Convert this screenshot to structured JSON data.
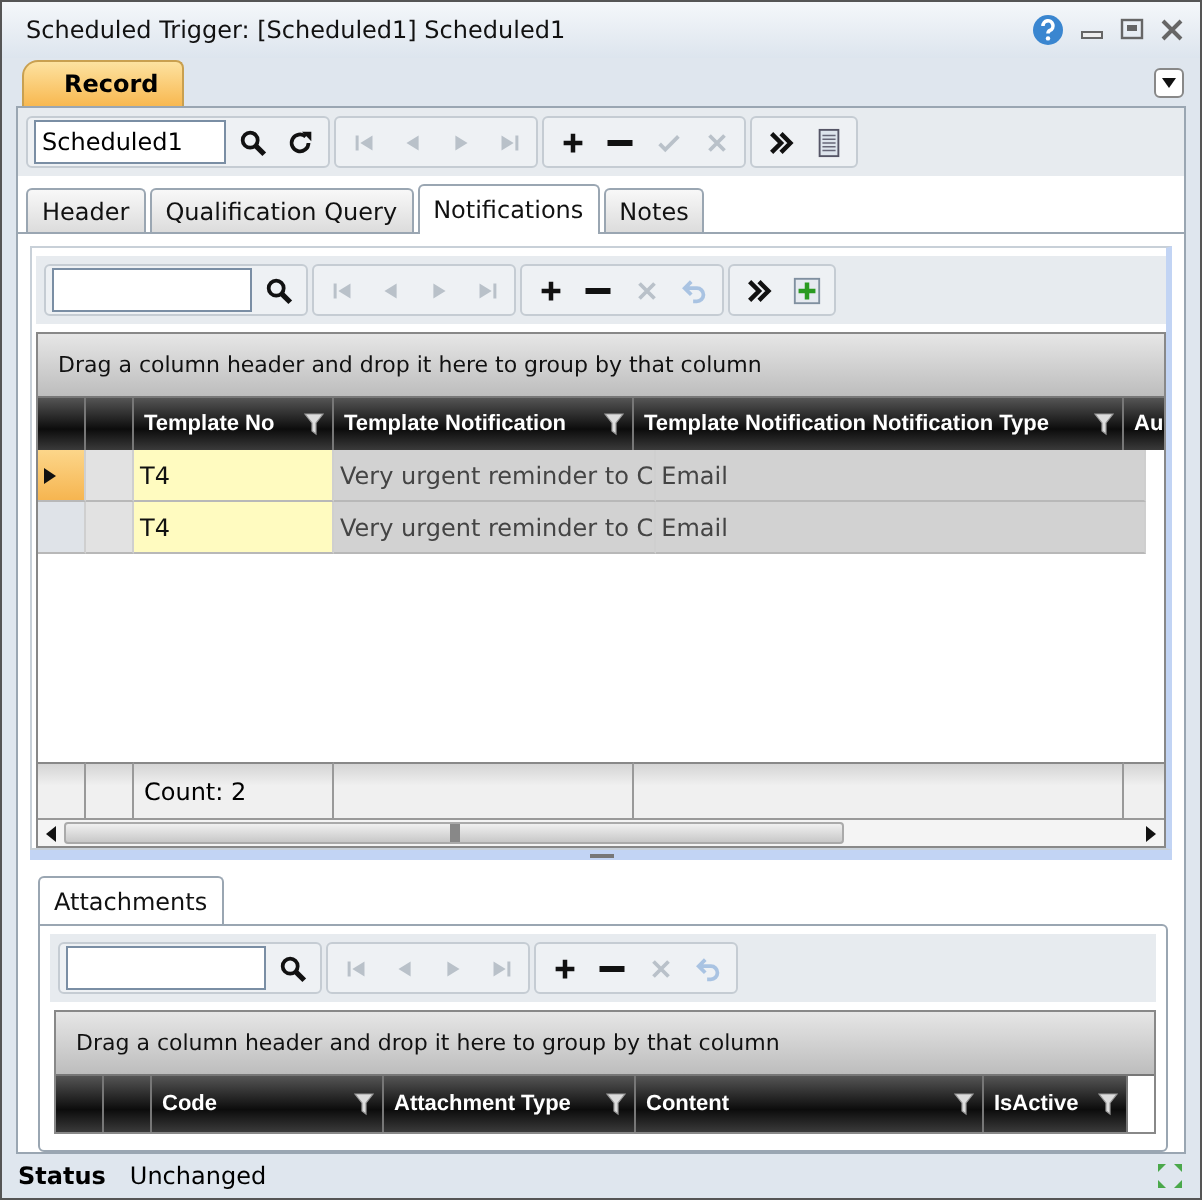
{
  "window": {
    "title": "Scheduled Trigger: [Scheduled1] Scheduled1"
  },
  "record_tab": {
    "label": "Record",
    "selected": true
  },
  "record_toolbar": {
    "value": "Scheduled1",
    "groups": [
      [
        {
          "kind": "search",
          "disabled": false
        },
        {
          "kind": "refresh",
          "disabled": false
        }
      ],
      [
        {
          "kind": "first",
          "disabled": true
        },
        {
          "kind": "previous",
          "disabled": true
        },
        {
          "kind": "next",
          "disabled": true
        },
        {
          "kind": "last",
          "disabled": true
        }
      ],
      [
        {
          "kind": "add",
          "disabled": false
        },
        {
          "kind": "remove",
          "disabled": false
        },
        {
          "kind": "save",
          "disabled": true
        },
        {
          "kind": "cancel",
          "disabled": true
        }
      ],
      [
        {
          "kind": "more",
          "disabled": false
        },
        {
          "kind": "columns",
          "disabled": false
        }
      ]
    ]
  },
  "tabs": [
    {
      "label": "Header",
      "selected": false
    },
    {
      "label": "Qualification Query",
      "selected": false
    },
    {
      "label": "Notifications",
      "selected": true
    },
    {
      "label": "Notes",
      "selected": false
    }
  ],
  "notifications": {
    "toolbar": {
      "groups": [
        [
          {
            "kind": "search",
            "disabled": false
          }
        ],
        [
          {
            "kind": "first",
            "disabled": true
          },
          {
            "kind": "previous",
            "disabled": true
          },
          {
            "kind": "next",
            "disabled": true
          },
          {
            "kind": "last",
            "disabled": true
          }
        ],
        [
          {
            "kind": "add",
            "disabled": false
          },
          {
            "kind": "remove",
            "disabled": false
          },
          {
            "kind": "cancel",
            "disabled": true
          },
          {
            "kind": "undo",
            "disabled": true
          }
        ],
        [
          {
            "kind": "more",
            "disabled": false
          },
          {
            "kind": "insert",
            "disabled": false
          }
        ]
      ]
    },
    "group_hint": "Drag a column header and drop it here to group by that column",
    "columns": [
      "Template No",
      "Template Notification",
      "Template Notification Notification Type",
      "Au"
    ],
    "rows": [
      {
        "selected": true,
        "cells": [
          "T4",
          "Very urgent reminder to C",
          "Email"
        ]
      },
      {
        "selected": false,
        "cells": [
          "T4",
          "Very urgent reminder to C",
          "Email"
        ]
      }
    ],
    "footer": "Count: 2"
  },
  "attachments": {
    "tab": {
      "label": "Attachments",
      "selected": true
    },
    "toolbar": {
      "groups": [
        [
          {
            "kind": "search",
            "disabled": false
          }
        ],
        [
          {
            "kind": "first",
            "disabled": true
          },
          {
            "kind": "previous",
            "disabled": true
          },
          {
            "kind": "next",
            "disabled": true
          },
          {
            "kind": "last",
            "disabled": true
          }
        ],
        [
          {
            "kind": "add",
            "disabled": false
          },
          {
            "kind": "remove",
            "disabled": false
          },
          {
            "kind": "cancel",
            "disabled": true
          },
          {
            "kind": "undo",
            "disabled": true
          }
        ]
      ]
    },
    "group_hint": "Drag a column header and drop it here to group by that column",
    "columns": [
      "Code",
      "Attachment Type",
      "Content",
      "IsActive"
    ]
  },
  "status_bar": {
    "label": "Status",
    "value": "Unchanged"
  }
}
